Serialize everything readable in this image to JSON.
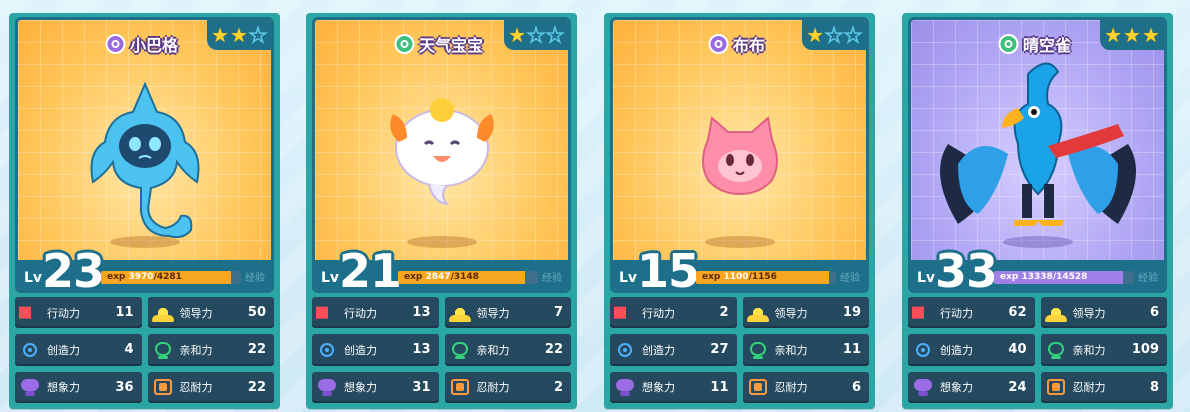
{
  "cards": [
    {
      "name": "小巴格",
      "type_color": "purple",
      "stars_on": 2,
      "level": "23",
      "lv_label": "Lv",
      "exp_prefix": "exp",
      "exp_current": "3970",
      "exp_max": "/4281",
      "exp_fraction": 0.927,
      "exp_label": "经验",
      "theme": "orange",
      "stats": [
        {
          "label": "行动力",
          "value": "11",
          "icon": "action-icon"
        },
        {
          "label": "领导力",
          "value": "50",
          "icon": "leadership-icon"
        },
        {
          "label": "创造力",
          "value": "4",
          "icon": "creativity-icon"
        },
        {
          "label": "亲和力",
          "value": "22",
          "icon": "affinity-icon"
        },
        {
          "label": "想象力",
          "value": "36",
          "icon": "imagination-icon"
        },
        {
          "label": "忍耐力",
          "value": "22",
          "icon": "endurance-icon"
        }
      ]
    },
    {
      "name": "天气宝宝",
      "type_color": "green",
      "stars_on": 1,
      "level": "21",
      "lv_label": "Lv",
      "exp_prefix": "exp",
      "exp_current": "2847",
      "exp_max": "/3148",
      "exp_fraction": 0.904,
      "exp_label": "经验",
      "theme": "orange",
      "stats": [
        {
          "label": "行动力",
          "value": "13",
          "icon": "action-icon"
        },
        {
          "label": "领导力",
          "value": "7",
          "icon": "leadership-icon"
        },
        {
          "label": "创造力",
          "value": "13",
          "icon": "creativity-icon"
        },
        {
          "label": "亲和力",
          "value": "22",
          "icon": "affinity-icon"
        },
        {
          "label": "想象力",
          "value": "31",
          "icon": "imagination-icon"
        },
        {
          "label": "忍耐力",
          "value": "2",
          "icon": "endurance-icon"
        }
      ]
    },
    {
      "name": "布布",
      "type_color": "purple",
      "stars_on": 1,
      "level": "15",
      "lv_label": "Lv",
      "exp_prefix": "exp",
      "exp_current": "1100",
      "exp_max": "/1156",
      "exp_fraction": 0.952,
      "exp_label": "经验",
      "theme": "orange",
      "stats": [
        {
          "label": "行动力",
          "value": "2",
          "icon": "action-icon"
        },
        {
          "label": "领导力",
          "value": "19",
          "icon": "leadership-icon"
        },
        {
          "label": "创造力",
          "value": "27",
          "icon": "creativity-icon"
        },
        {
          "label": "亲和力",
          "value": "11",
          "icon": "affinity-icon"
        },
        {
          "label": "想象力",
          "value": "11",
          "icon": "imagination-icon"
        },
        {
          "label": "忍耐力",
          "value": "6",
          "icon": "endurance-icon"
        }
      ]
    },
    {
      "name": "晴空雀",
      "type_color": "green",
      "stars_on": 3,
      "level": "33",
      "lv_label": "Lv",
      "exp_prefix": "exp",
      "exp_current": "13338",
      "exp_max": "/14528",
      "exp_fraction": 0.918,
      "exp_label": "经验",
      "theme": "purple",
      "stats": [
        {
          "label": "行动力",
          "value": "62",
          "icon": "action-icon"
        },
        {
          "label": "领导力",
          "value": "6",
          "icon": "leadership-icon"
        },
        {
          "label": "创造力",
          "value": "40",
          "icon": "creativity-icon"
        },
        {
          "label": "亲和力",
          "value": "109",
          "icon": "affinity-icon"
        },
        {
          "label": "想象力",
          "value": "24",
          "icon": "imagination-icon"
        },
        {
          "label": "忍耐力",
          "value": "8",
          "icon": "endurance-icon"
        }
      ]
    }
  ],
  "colors": {
    "card_bg": "#2aa7a5",
    "frame_border": "#1d6f8a",
    "stat_bg": "#25495e",
    "exp_orange": "#f6a621",
    "exp_purple": "#9f7fe8",
    "star_on": "#ffd22e"
  }
}
